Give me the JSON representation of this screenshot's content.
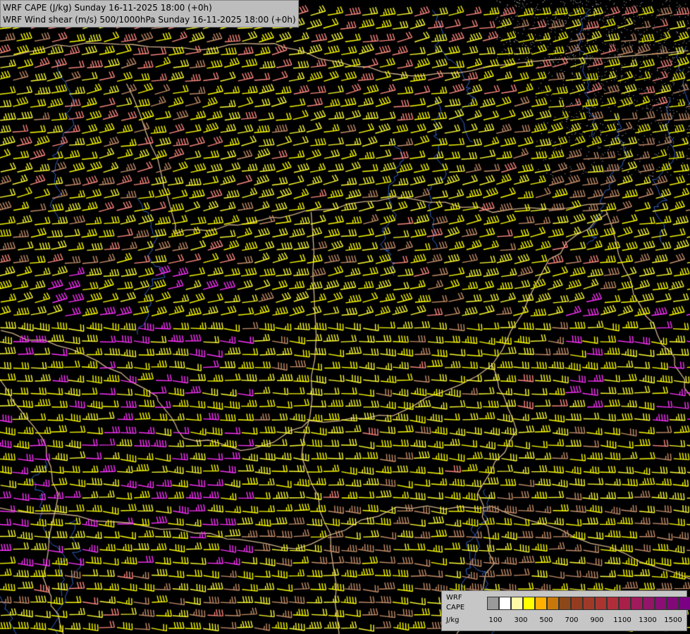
{
  "titles": {
    "line1": "WRF CAPE (J/kg) Sunday 16-11-2025 18:00 (+0h)",
    "line2": "WRF Wind shear (m/s) 500/1000hPa Sunday 16-11-2025 18:00 (+0h)"
  },
  "legend": {
    "label1": "WRF",
    "label2": "CAPE",
    "label3": "J/kg",
    "colors": [
      "#9a9a9a",
      "#ffffff",
      "#fffaa8",
      "#ffff00",
      "#ffb000",
      "#c8780a",
      "#8c4818",
      "#963c1e",
      "#a03a28",
      "#aa3430",
      "#b02e3a",
      "#a8204a",
      "#a01a5c",
      "#941468",
      "#8a0e74",
      "#82087a",
      "#7a0084"
    ],
    "ticks": [
      "100",
      "300",
      "500",
      "700",
      "900",
      "1100",
      "1300",
      "1500"
    ]
  },
  "map_style": {
    "background": "#000000",
    "barb_palette": [
      "#ffff33",
      "#ffff00",
      "#ffe066",
      "#ff8a80",
      "#ff6a6a",
      "#c8906a",
      "#ff33ff",
      "#cc44cc",
      "#ffd24d"
    ],
    "border_color": "#d2b48c",
    "river_color": "#3366cc"
  }
}
